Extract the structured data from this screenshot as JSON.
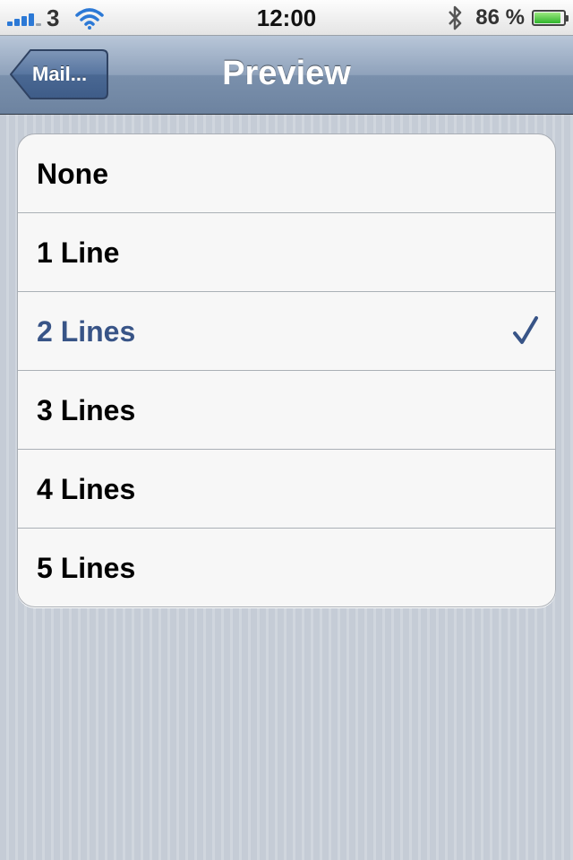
{
  "status_bar": {
    "carrier": "3",
    "time": "12:00",
    "battery_percent": "86 %",
    "battery_level": 0.86,
    "signal_bars": 4
  },
  "nav": {
    "back_label": "Mail...",
    "title": "Preview"
  },
  "options": [
    {
      "label": "None",
      "selected": false
    },
    {
      "label": "1 Line",
      "selected": false
    },
    {
      "label": "2 Lines",
      "selected": true
    },
    {
      "label": "3 Lines",
      "selected": false
    },
    {
      "label": "4 Lines",
      "selected": false
    },
    {
      "label": "5 Lines",
      "selected": false
    }
  ],
  "colors": {
    "selected_text": "#385487",
    "signal": "#2c79d6",
    "battery_fill": "#2fb52c"
  },
  "icons": [
    "signal-icon",
    "wifi-icon",
    "bluetooth-icon",
    "battery-icon",
    "back-arrow-icon",
    "checkmark-icon"
  ]
}
